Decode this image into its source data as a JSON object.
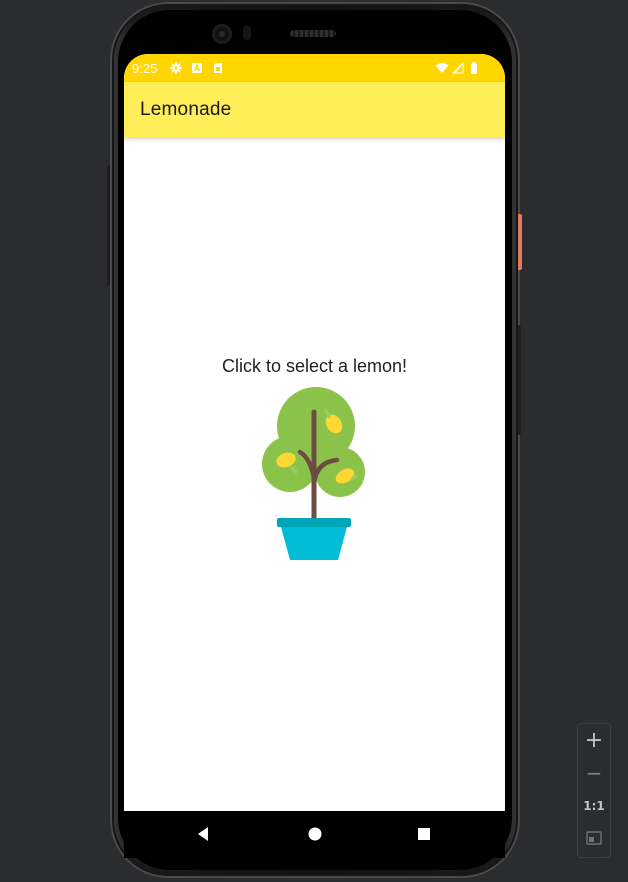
{
  "status_bar": {
    "time": "9:25",
    "icons": [
      "gear-icon",
      "a-icon",
      "sim-card-icon"
    ],
    "right_icons": [
      "wifi-icon",
      "signal-icon",
      "battery-icon"
    ],
    "background": "#ffd600"
  },
  "app_bar": {
    "title": "Lemonade",
    "background": "#ffee58"
  },
  "main": {
    "prompt": "Click to select a lemon!",
    "image": "lemon-tree-icon"
  },
  "nav_bar": {
    "buttons": [
      "back-icon",
      "home-icon",
      "recents-icon"
    ]
  },
  "emulator_toolbar": {
    "zoom_in": "+",
    "zoom_out": "−",
    "actual_size": "1:1",
    "fit_screen": "fit-screen-icon"
  },
  "colors": {
    "tree_foliage": "#8bc34a",
    "tree_trunk": "#6d4c41",
    "lemon": "#fdd835",
    "pot": "#00bcd4",
    "pot_rim": "#00a5b8"
  }
}
